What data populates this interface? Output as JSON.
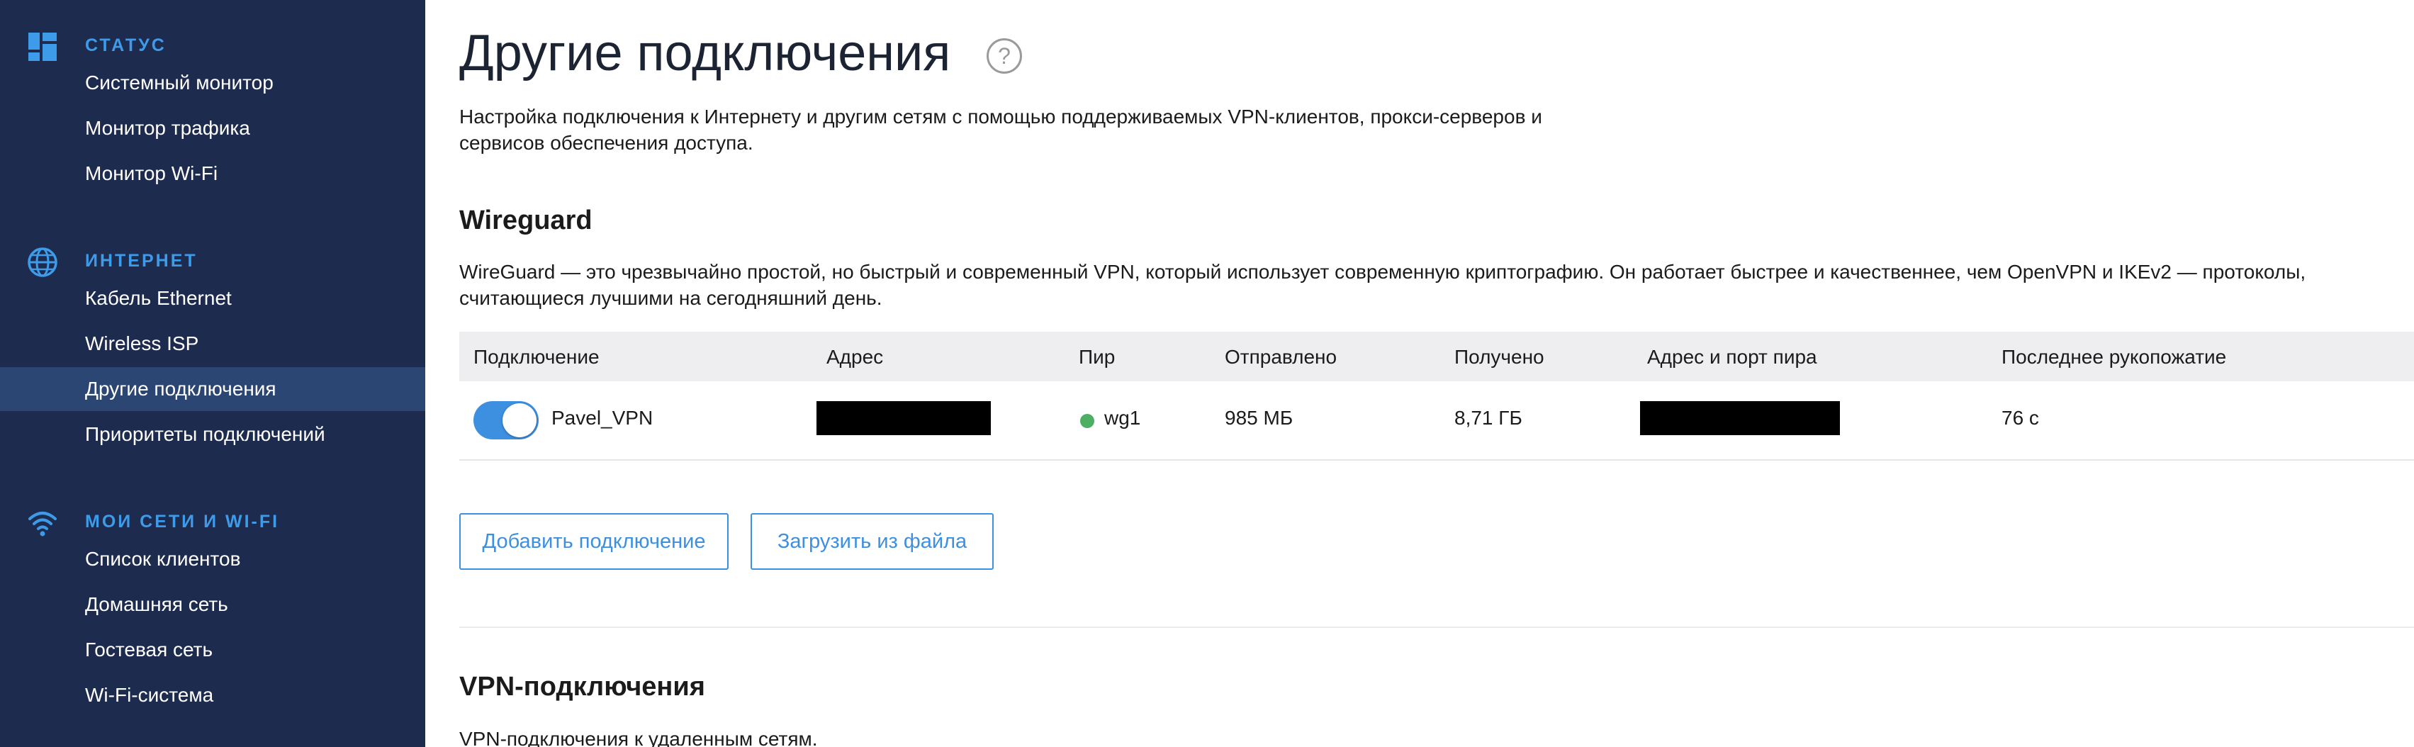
{
  "sidebar": {
    "sections": [
      {
        "title": "СТАТУС",
        "icon": "dashboard-icon",
        "items": [
          {
            "label": "Системный монитор"
          },
          {
            "label": "Монитор трафика"
          },
          {
            "label": "Монитор Wi-Fi"
          }
        ]
      },
      {
        "title": "ИНТЕРНЕТ",
        "icon": "globe-icon",
        "items": [
          {
            "label": "Кабель Ethernet"
          },
          {
            "label": "Wireless ISP"
          },
          {
            "label": "Другие подключения",
            "active": true
          },
          {
            "label": "Приоритеты подключений"
          }
        ]
      },
      {
        "title": "МОИ СЕТИ И WI-FI",
        "icon": "wifi-icon",
        "items": [
          {
            "label": "Список клиентов"
          },
          {
            "label": "Домашняя сеть"
          },
          {
            "label": "Гостевая сеть"
          },
          {
            "label": "Wi-Fi-система"
          }
        ]
      }
    ]
  },
  "main": {
    "title": "Другие подключения",
    "help_glyph": "?",
    "description_line1": "Настройка подключения к Интернету и другим сетям с помощью поддерживаемых VPN-клиентов, прокси-серверов и",
    "description_line2": "сервисов обеспечения доступа.",
    "wireguard": {
      "title": "Wireguard",
      "description_line1": "WireGuard — это чрезвычайно простой, но быстрый и современный VPN, который использует современную криптографию. Он работает быстрее и качественнее, чем OpenVPN и IKEv2 — протоколы,",
      "description_line2": "считающиеся лучшими на сегодняшний день.",
      "columns": [
        "Подключение",
        "Адрес",
        "Пир",
        "Отправлено",
        "Получено",
        "Адрес и порт пира",
        "Последнее рукопожатие"
      ],
      "rows": [
        {
          "enabled": true,
          "name": "Pavel_VPN",
          "address": "",
          "peer": "wg1",
          "peer_status_color": "#4caf63",
          "sent": "985 МБ",
          "received": "8,71 ГБ",
          "peer_address": "",
          "last_handshake": "76 с"
        }
      ],
      "add_button": "Добавить подключение",
      "upload_button": "Загрузить из файла"
    },
    "vpn": {
      "title": "VPN-подключения",
      "description": "VPN-подключения к удаленным сетям."
    }
  },
  "colors": {
    "sidebar_bg": "#1d2b4e",
    "sidebar_active": "#2b4672",
    "accent": "#3d8fe0",
    "section_title": "#3d9bea"
  }
}
